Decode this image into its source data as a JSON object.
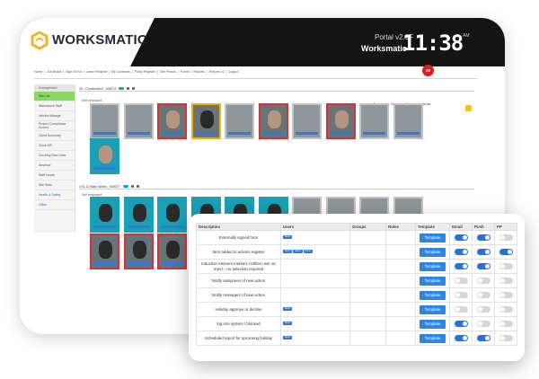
{
  "brand": {
    "name": "WORKSMATIC",
    "portal": "Portal v2.0F",
    "sub": "Worksmatic",
    "time": "11:38",
    "ampm": "AM"
  },
  "nav": [
    "Home",
    "Job Board",
    "Sign In/Out",
    "Leave Request",
    "My Contracts",
    "Policy Register",
    "Site Photos",
    "Forms",
    "Reports",
    "Reports v2",
    "Logout"
  ],
  "notifications": "46",
  "sidebar": {
    "header": "Management",
    "items": [
      "Site List",
      "Attendance Staff",
      "Vehicle Mileage",
      "Project Compliance Scores",
      "Client Summary",
      "Clock KPI",
      "Clocking Raw Data",
      "Absence",
      "Staff Leads",
      "Site Stats"
    ],
    "links": [
      "Health & Safety",
      "Office"
    ],
    "colors": {
      "active": "#8ad864"
    }
  },
  "sections": [
    {
      "title": "26 - Construction",
      "code": "#05274",
      "sub": "Self employed"
    },
    {
      "title": "CSL 12 Main Works",
      "code": "#05377",
      "sub": "Self employed"
    }
  ],
  "refresh_text": "Refresh for: Seconds, 10 second interval",
  "table": {
    "headers": [
      "Description",
      "Users",
      "Groups",
      "Roles",
      "Template",
      "Email",
      "Push",
      "PP"
    ],
    "template_label": "Template",
    "rows": [
      {
        "desc": "Externally signed form",
        "users": [
          "demo"
        ],
        "email": true,
        "push": true,
        "pp": false
      },
      {
        "desc": "Item added to actions register",
        "users": [
          "demo",
          "demo",
          "demo"
        ],
        "email": true,
        "push": true,
        "pp": true
      },
      {
        "desc": "Induction element marked, notifies user on reject - no selection required",
        "users": [],
        "email": true,
        "push": true,
        "pp": false
      },
      {
        "desc": "Notify assignees of new action",
        "users": [],
        "email": false,
        "push": false,
        "pp": false
      },
      {
        "desc": "Notify managers of new action",
        "users": [],
        "email": false,
        "push": false,
        "pp": false
      },
      {
        "desc": "Holiday approve or decline",
        "users": [
          "demo"
        ],
        "email": false,
        "push": false,
        "pp": false
      },
      {
        "desc": "log into system / blocked",
        "users": [
          "demo"
        ],
        "email": true,
        "push": false,
        "pp": false
      },
      {
        "desc": "Scheduled report for upcoming holiday",
        "users": [
          "demo"
        ],
        "email": true,
        "push": true,
        "pp": false
      }
    ],
    "colors": {
      "toggle_on": "#1e73e8",
      "toggle_off": "#d6d6d6",
      "button": "#2e86de"
    }
  }
}
